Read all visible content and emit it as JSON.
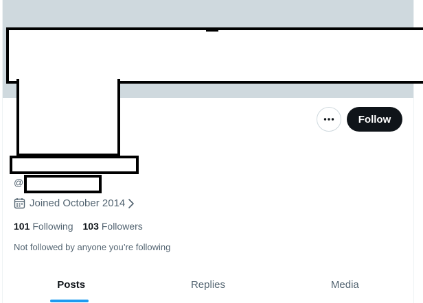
{
  "profile": {
    "handle_prefix": "@",
    "joined_text": "Joined October 2014",
    "following_count": "101",
    "following_label": "Following",
    "followers_count": "103",
    "followers_label": "Followers",
    "not_followed_text": "Not followed by anyone you’re following"
  },
  "actions": {
    "follow_label": "Follow",
    "more_icon": "more-horizontal-icon"
  },
  "tabs": [
    {
      "label": "Posts",
      "active": true
    },
    {
      "label": "Replies",
      "active": false
    },
    {
      "label": "Media",
      "active": false
    }
  ],
  "colors": {
    "banner": "#cfd9de",
    "follow_button": "#0f1419",
    "tab_indicator": "#1d9bf0",
    "secondary_text": "#536471"
  },
  "icons": {
    "calendar": "calendar-icon",
    "chevron": "chevron-right-icon"
  }
}
